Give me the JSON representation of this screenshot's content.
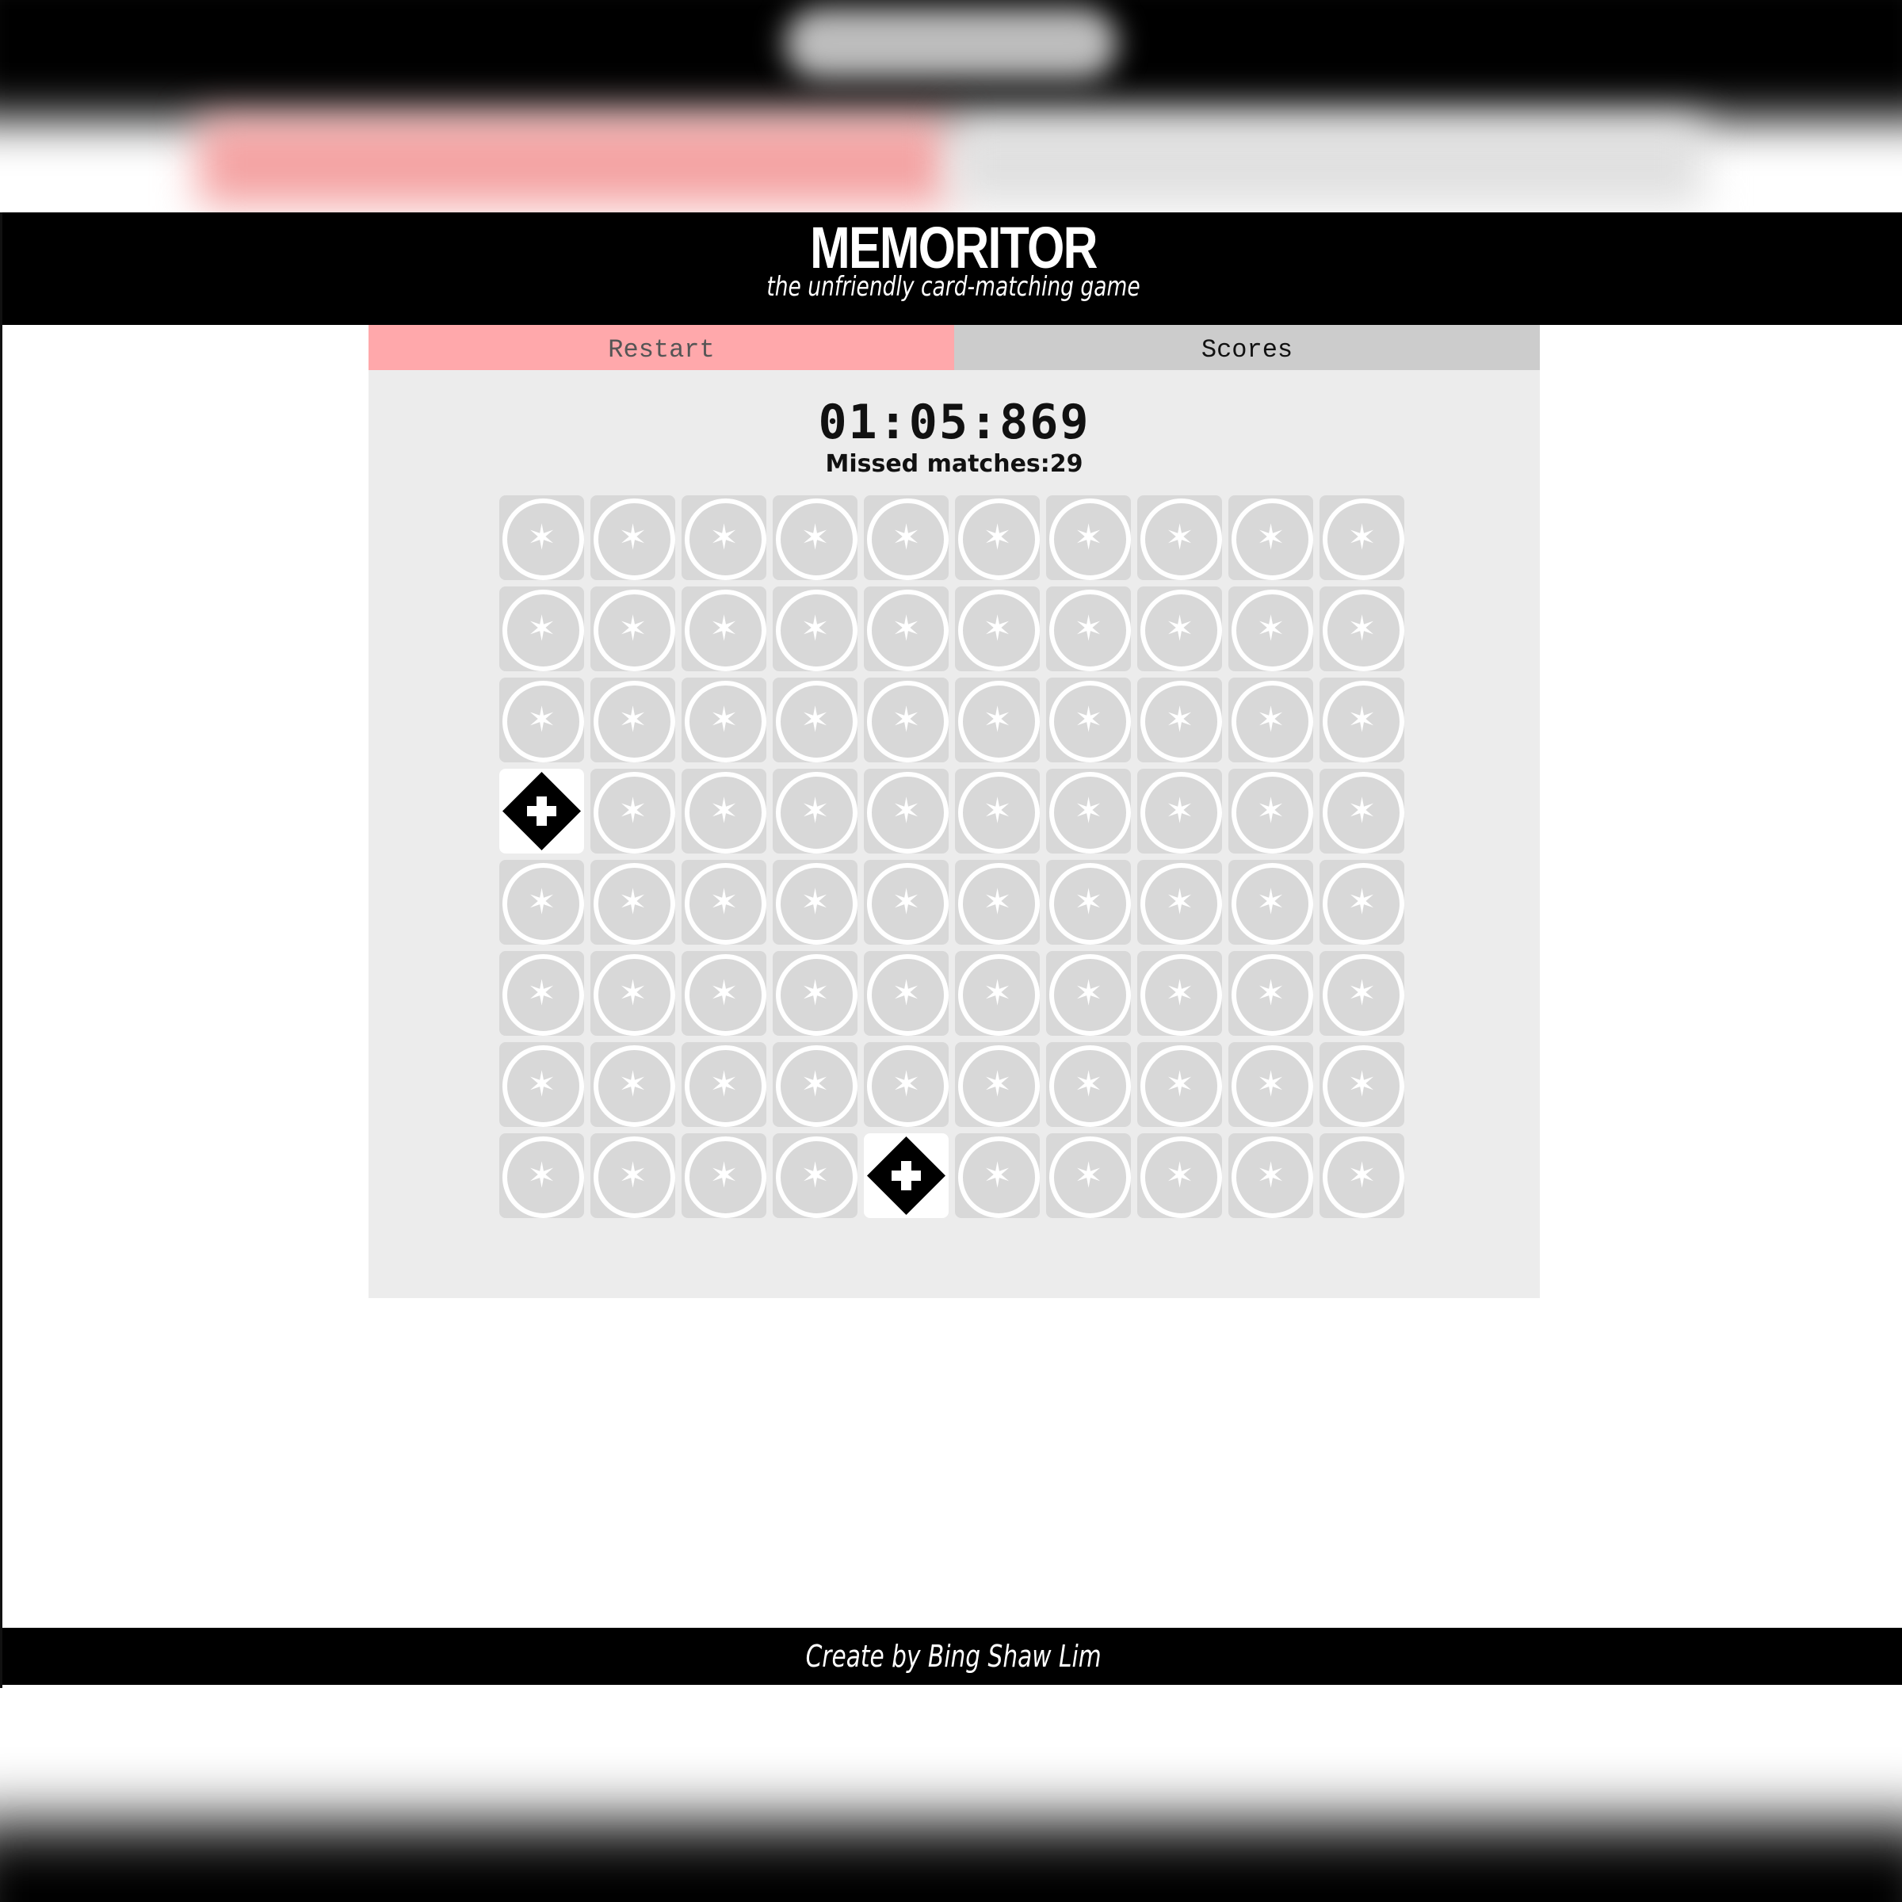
{
  "app": {
    "title": "MEMORITOR",
    "subtitle": "the unfriendly card-matching game"
  },
  "tabs": {
    "restart_label": "Restart",
    "scores_label": "Scores"
  },
  "status": {
    "timer": "01:05:869",
    "missed_label": "Missed matches:",
    "missed_count": "29"
  },
  "board": {
    "rows": 8,
    "cols": 10,
    "card_back_icon": "star-in-circle-icon",
    "revealed_icon": "diamond-cross-icon",
    "revealed_cards": [
      {
        "row": 3,
        "col": 0
      },
      {
        "row": 7,
        "col": 4
      }
    ]
  },
  "footer": {
    "credit": "Create by Bing Shaw Lim"
  },
  "colors": {
    "restart_tab": "#ffa8ab",
    "scores_tab": "#cccccc",
    "panel": "#ececec",
    "card_back": "#d8d8d8",
    "header_bg": "#000000"
  }
}
